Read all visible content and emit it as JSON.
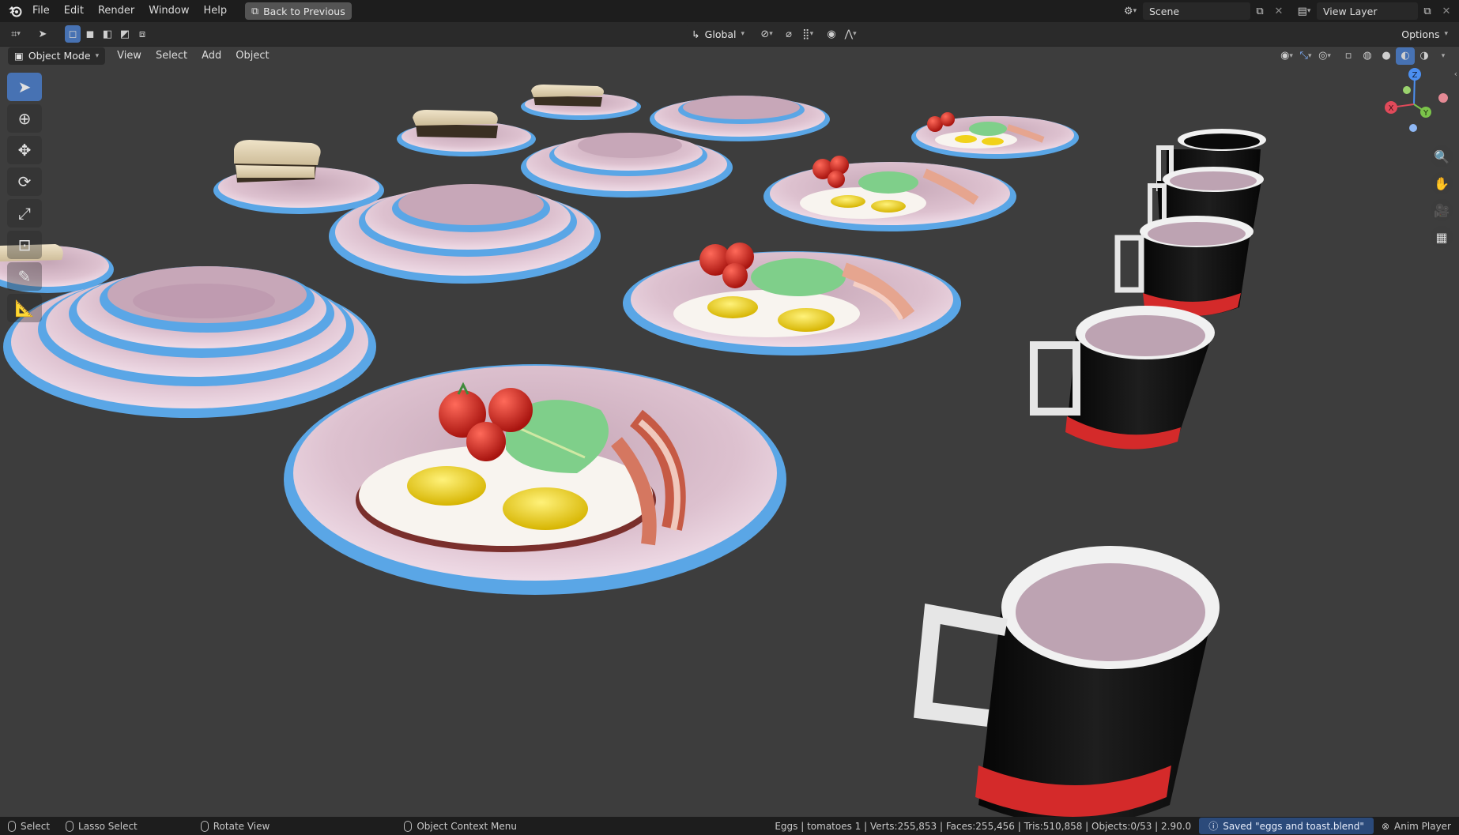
{
  "app": {
    "logo_icon": "blender-logo-icon"
  },
  "topbar": {
    "menus": [
      {
        "label": "File"
      },
      {
        "label": "Edit"
      },
      {
        "label": "Render"
      },
      {
        "label": "Window"
      },
      {
        "label": "Help"
      }
    ],
    "back_button": "Back to Previous",
    "scene_field": "Scene",
    "view_layer_field": "View Layer"
  },
  "toolbar": {
    "orientation": "Global",
    "options": "Options"
  },
  "header": {
    "mode": "Object Mode",
    "menus": [
      {
        "label": "View"
      },
      {
        "label": "Select"
      },
      {
        "label": "Add"
      },
      {
        "label": "Object"
      }
    ]
  },
  "tools": [
    "select-box-icon",
    "cursor-icon",
    "move-icon",
    "rotate-icon",
    "scale-icon",
    "transform-icon",
    "annotate-icon",
    "measure-icon"
  ],
  "gizmo": {
    "x": "X",
    "y": "Y",
    "z": "Z"
  },
  "statusbar": {
    "select": "Select",
    "lasso": "Lasso Select",
    "rotate": "Rotate View",
    "context": "Object Context Menu",
    "stats": "Eggs | tomatoes 1 | Verts:255,853 | Faces:255,456 | Tris:510,858 | Objects:0/53 | 2.90.0",
    "saved": "Saved \"eggs and toast.blend\"",
    "anim_player": "Anim Player"
  },
  "colors": {
    "accent": "#4772b3",
    "plate_rim": "#5aa6e6",
    "plate_body": "#d9b9c8",
    "mug_red": "#d42a2a"
  }
}
